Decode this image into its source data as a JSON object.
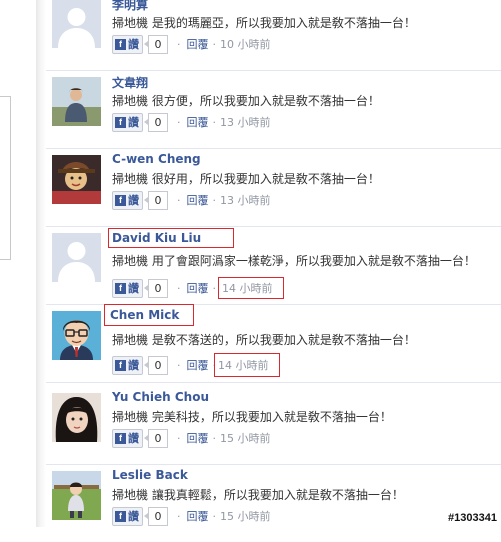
{
  "ui": {
    "like_label": "讚",
    "reply_label": "回覆",
    "dot": "·"
  },
  "comments": [
    {
      "name": "李明算",
      "text": "掃地機 是我的瑪麗亞，所以我要加入就是敎不落抽一台！",
      "likes": "0",
      "time": "10 小時前",
      "highlight_name": false,
      "highlight_time": false
    },
    {
      "name": "文韋翔",
      "text": "掃地機 很方便，所以我要加入就是敎不落抽一台！",
      "likes": "0",
      "time": "13 小時前",
      "highlight_name": false,
      "highlight_time": false
    },
    {
      "name": "C-wen Cheng",
      "text": "掃地機 很好用，所以我要加入就是敎不落抽一台！",
      "likes": "0",
      "time": "13 小時前",
      "highlight_name": false,
      "highlight_time": false
    },
    {
      "name": "David Kiu Liu",
      "text": "掃地機 用了會跟阿潙家一樣乾淨，所以我要加入就是敎不落抽一台！",
      "likes": "0",
      "time": "14 小時前",
      "highlight_name": true,
      "highlight_time": true
    },
    {
      "name": "Chen Mick",
      "text": "掃地機 是敎不落送的，所以我要加入就是敎不落抽一台！",
      "likes": "0",
      "time": "14 小時前",
      "highlight_name": true,
      "highlight_time": true
    },
    {
      "name": "Yu Chieh Chou",
      "text": "掃地機 完美科技，所以我要加入就是敎不落抽一台！",
      "likes": "0",
      "time": "15 小時前",
      "highlight_name": false,
      "highlight_time": false
    },
    {
      "name": "Leslie Back",
      "text": "掃地機 讓我真輕鬆，所以我要加入就是敎不落抽一台！",
      "likes": "0",
      "time": "15 小時前",
      "highlight_name": false,
      "highlight_time": false
    }
  ],
  "watermark": "#1303341"
}
